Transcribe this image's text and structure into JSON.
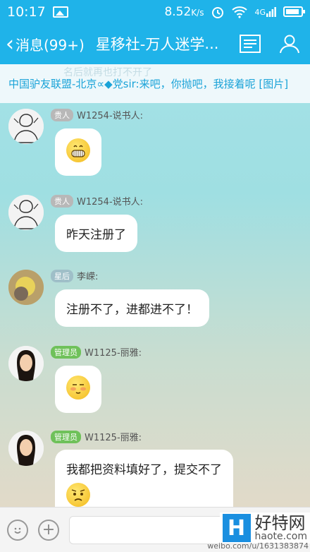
{
  "status_bar": {
    "time": "10:17",
    "speed": "8.52",
    "speed_unit": "K/s",
    "network": "4G"
  },
  "title_bar": {
    "back_label": "消息(99+)",
    "title": "星移社-万人迷学",
    "title_ellipsis": "..."
  },
  "notice": {
    "ghost_text": "名后就再也打不开了",
    "text": "中国驴友联盟-北京∝◆党sir:来吧，你抛吧，我接着呢 [图片]"
  },
  "messages": [
    {
      "tag": "贵人",
      "tag_color": "#b8b8b8",
      "sender": "W1254-说书人:",
      "text": "",
      "emoji": "grin"
    },
    {
      "tag": "贵人",
      "tag_color": "#b8b8b8",
      "sender": "W1254-说书人:",
      "text": "昨天注册了",
      "emoji": ""
    },
    {
      "tag": "星后",
      "tag_color": "#9fbfc8",
      "sender": "李嵘:",
      "text": "注册不了，进都进不了！",
      "emoji": ""
    },
    {
      "tag": "管理员",
      "tag_color": "#6fc15a",
      "sender": "W1125-丽雅:",
      "text": "",
      "emoji": "shy"
    },
    {
      "tag": "管理员",
      "tag_color": "#6fc15a",
      "sender": "W1125-丽雅:",
      "text": "我都把资料填好了，提交不了",
      "emoji": "confused"
    }
  ],
  "input": {
    "placeholder": ""
  },
  "watermark": {
    "cn": "好特网",
    "en": "haote.com",
    "logo": "H",
    "weibo": "weibo.com/u/1631383874"
  }
}
